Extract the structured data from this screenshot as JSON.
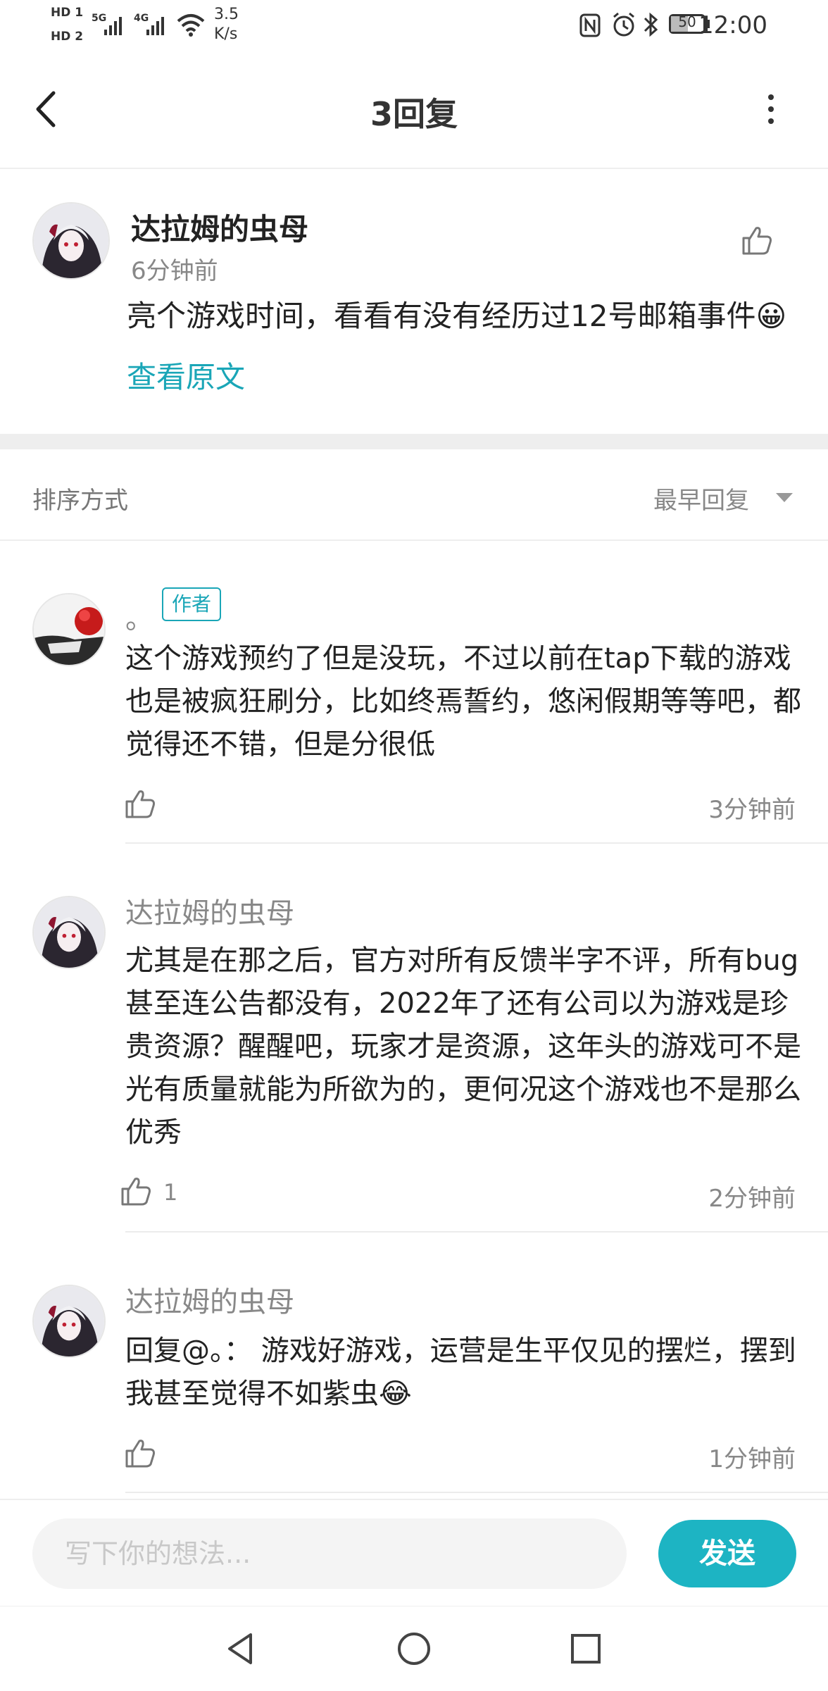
{
  "status_bar": {
    "hd1": "HD 1",
    "hd2": "HD 2",
    "net1": "5G",
    "net2": "4G",
    "speed_value": "3.5",
    "speed_unit": "K/s",
    "battery": "50",
    "time": "12:00"
  },
  "header": {
    "title": "3回复"
  },
  "post": {
    "author": "达拉姆的虫母",
    "time": "6分钟前",
    "content": "亮个游戏时间，看看有没有经历过12号邮箱事件😀",
    "view_original": "查看原文"
  },
  "sort": {
    "label": "排序方式",
    "value": "最早回复"
  },
  "replies": [
    {
      "author": "。",
      "badge": "作者",
      "content": "这个游戏预约了但是没玩，不过以前在tap下载的游戏也是被疯狂刷分，比如终焉誓约，悠闲假期等等吧，都觉得还不错，但是分很低",
      "time": "3分钟前",
      "likes": ""
    },
    {
      "author": "达拉姆的虫母",
      "content": "尤其是在那之后，官方对所有反馈半字不评，所有bug甚至连公告都没有，2022年了还有公司以为游戏是珍贵资源？醒醒吧，玩家才是资源，这年头的游戏可不是光有质量就能为所欲为的，更何况这个游戏也不是那么优秀",
      "time": "2分钟前",
      "likes": "1"
    },
    {
      "author": "达拉姆的虫母",
      "content": "回复@。：  游戏好游戏，运营是生平仅见的摆烂，摆到我甚至觉得不如紫虫😂",
      "time": "1分钟前",
      "likes": ""
    }
  ],
  "composer": {
    "placeholder": "写下你的想法...",
    "send_label": "发送"
  },
  "colors": {
    "accent": "#1aa6b7",
    "send_bg": "#1db4c3",
    "divider": "#eeeeee"
  }
}
